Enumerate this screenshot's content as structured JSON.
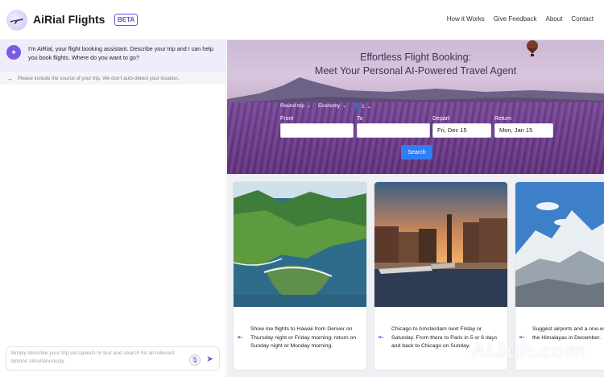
{
  "header": {
    "app_name": "AiRial Flights",
    "badge": "BETA",
    "logo_icon": "airplane-icon",
    "nav": [
      "How it Works",
      "Give Feedback",
      "About",
      "Contact"
    ]
  },
  "chat": {
    "assistant_message": "I'm AiRial, your flight booking assistant. Describe your trip and I can help you book flights. Where do you want to go?",
    "hint": "Please include the source of your trip. We don't auto-detect your location.",
    "input_placeholder": "Simply describe your trip via speech or text and search for all relevant options simultaneously.",
    "input_value": ""
  },
  "hero": {
    "title_line1": "Effortless Flight Booking:",
    "title_line2": "Meet Your Personal AI-Powered Travel Agent",
    "trip_type": "Round trip",
    "cabin_class": "Economy",
    "passengers": "1",
    "from_label": "From",
    "to_label": "To",
    "depart_label": "Depart",
    "return_label": "Return",
    "from_value": "",
    "to_value": "",
    "depart_value": "Fri, Dec 15",
    "return_value": "Mon, Jan 15",
    "search_label": "Search"
  },
  "cards": [
    {
      "text": "Show me flights to Hawaii from Denver on Thursday night or Friday morning; return on Sunday night or Monday morning."
    },
    {
      "text": "Chicago to Amsterdam next Friday or Saturday. From there to Paris in 5 or 6 days and back to Chicago on Sunday."
    },
    {
      "text": "Suggest airports and a one-way trip to explore the Himalayas in December."
    }
  ],
  "watermark": "AiJuh.com",
  "colors": {
    "accent": "#6b4bd6",
    "search": "#2f7ff3",
    "lavender": "#6e3f8e"
  }
}
